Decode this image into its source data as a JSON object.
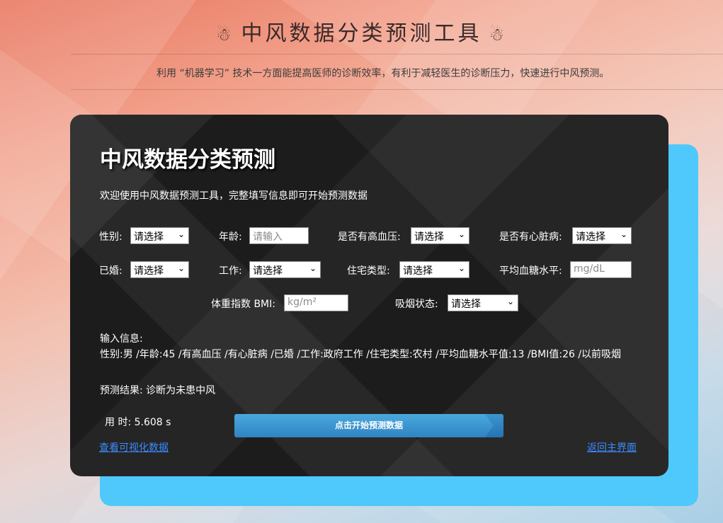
{
  "header": {
    "title": "中风数据分类预测工具",
    "title_icon": "snowman-icon",
    "subtitle": "利用 “机器学习” 技术一方面能提高医师的诊断效率，有利于减轻医生的诊断压力，快速进行中风预测。"
  },
  "card": {
    "title": "中风数据分类预测",
    "welcome": "欢迎使用中风数据预测工具，完整填写信息即可开始预测数据"
  },
  "form": {
    "gender_label": "性别:",
    "gender_value": "请选择",
    "age_label": "年龄:",
    "age_placeholder": "请输入",
    "hypertension_label": "是否有高血压:",
    "hypertension_value": "请选择",
    "heart_label": "是否有心脏病:",
    "heart_value": "请选择",
    "married_label": "已婚:",
    "married_value": "请选择",
    "work_label": "工作:",
    "work_value": "请选择",
    "residence_label": "住宅类型:",
    "residence_value": "请选择",
    "glucose_label": "平均血糖水平:",
    "glucose_placeholder": "mg/dL",
    "bmi_label": "体重指数 BMI:",
    "bmi_placeholder": "kg/m²",
    "smoking_label": "吸烟状态:",
    "smoking_value": "请选择"
  },
  "info": {
    "heading": "输入信息:",
    "line": "性别:男 /年龄:45 /有高血压 /有心脏病 /已婚 /工作:政府工作 /住宅类型:农村 /平均血糖水平值:13 /BMI值:26 /以前吸烟"
  },
  "result": {
    "text": "预测结果:  诊断为未患中风"
  },
  "timing": {
    "text": "用  时: 5.608 s"
  },
  "actions": {
    "predict_label": "点击开始预测数据",
    "visualize_link": "查看可视化数据",
    "home_link": "返回主界面"
  },
  "colors": {
    "accent_blue": "#4fc8fb",
    "card_bg": "#1c1c1d",
    "button_blue": "#3a96d0",
    "link_blue": "#3b8cff"
  }
}
